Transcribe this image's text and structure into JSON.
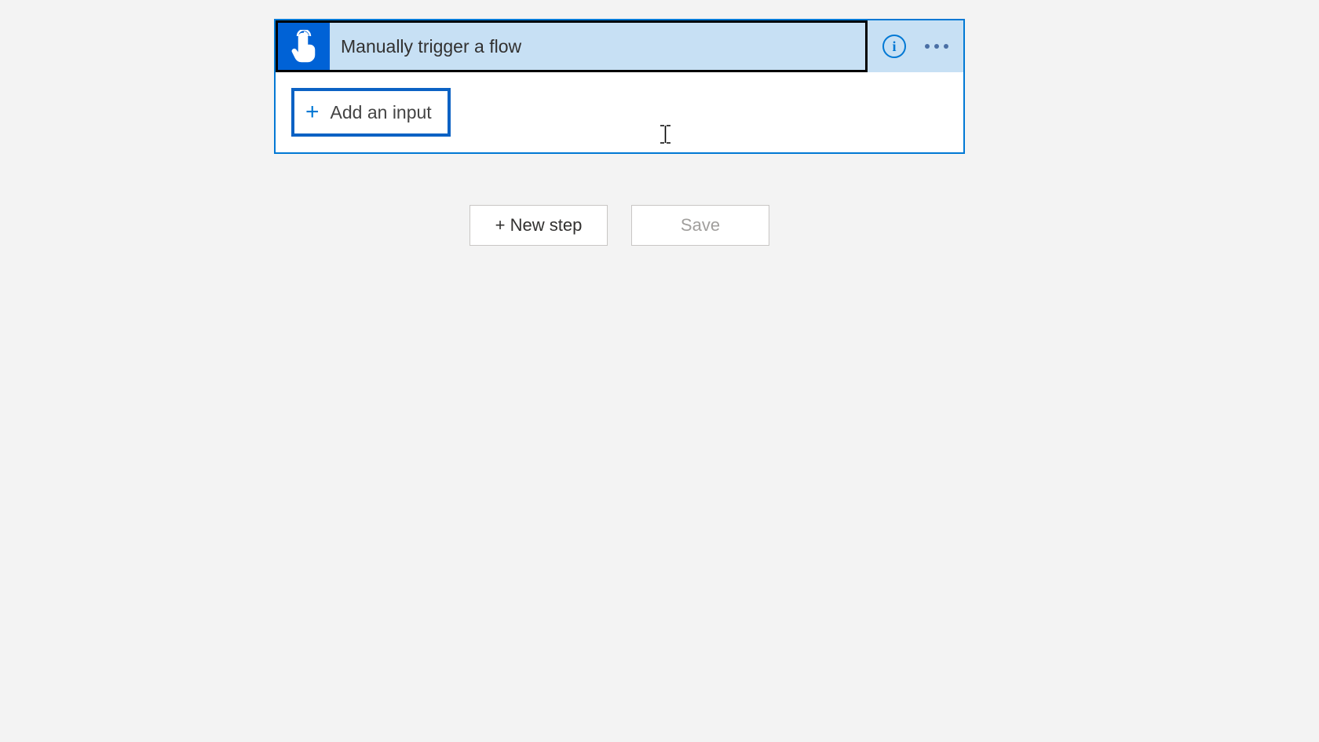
{
  "trigger_card": {
    "title": "Manually trigger a flow",
    "info_glyph": "i",
    "add_input_label": "Add an input",
    "plus_glyph": "+"
  },
  "actions": {
    "new_step_label": "+ New step",
    "save_label": "Save"
  }
}
